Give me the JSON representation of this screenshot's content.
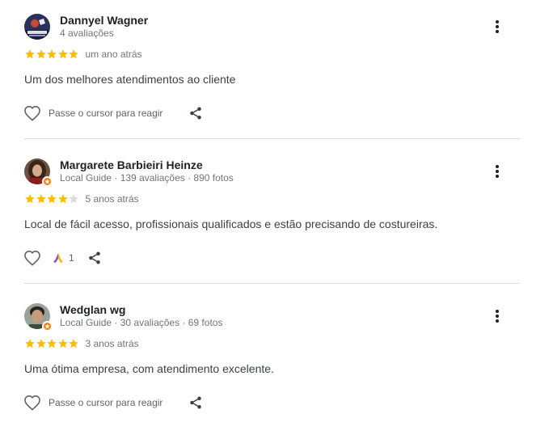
{
  "reviews": [
    {
      "name": "Dannyel Wagner",
      "meta": "4 avaliações",
      "stars": 5,
      "date": "um ano atrás",
      "text": "Um dos melhores atendimentos ao cliente",
      "hover_hint": "Passe o cursor para reagir",
      "local_guide": false,
      "avatar_icon": "profile-photo",
      "avatar_caption": "ESTE VIVES"
    },
    {
      "name": "Margarete Barbieiri Heinze",
      "meta": "Local Guide · 139 avaliações · 890 fotos",
      "stars": 4,
      "date": "5 anos atrás",
      "text": "Local de fácil acesso, profissionais qualificados e estão precisando de costureiras.",
      "reaction_count": "1",
      "reaction_icon": "praying-hands-emoji",
      "local_guide": true,
      "avatar_icon": "profile-photo"
    },
    {
      "name": "Wedglan wg",
      "meta": "Local Guide · 30 avaliações · 69 fotos",
      "stars": 5,
      "date": "3 anos atrás",
      "text": "Uma ótima empresa, com atendimento excelente.",
      "hover_hint": "Passe o cursor para reagir",
      "local_guide": true,
      "avatar_icon": "profile-photo"
    }
  ],
  "colors": {
    "star_filled": "#fbbc04",
    "star_empty": "#dadce0",
    "local_guide_badge": "#f57c00",
    "divider": "#dadce0",
    "icon": "#5f6368"
  }
}
